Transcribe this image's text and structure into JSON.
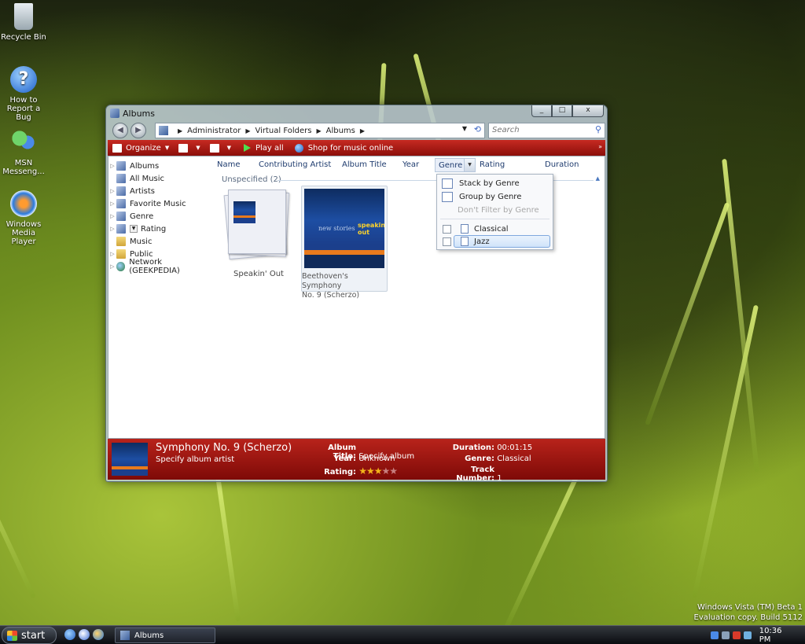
{
  "desktop": {
    "icons": [
      {
        "label": "Recycle Bin"
      },
      {
        "label": "How to Report a Bug"
      },
      {
        "label": "MSN Messeng..."
      },
      {
        "label": "Windows Media Player"
      }
    ],
    "watermark_line1": "Windows Vista (TM) Beta 1",
    "watermark_line2": "Evaluation copy. Build 5112"
  },
  "window": {
    "title": "Albums",
    "controls": {
      "minimize": "_",
      "maximize": "□",
      "close": "x"
    }
  },
  "address": {
    "crumbs": [
      "Administrator",
      "Virtual Folders",
      "Albums"
    ],
    "search_placeholder": "Search"
  },
  "toolbar": {
    "organize": "Organize",
    "play_all": "Play all",
    "shop": "Shop for music online",
    "more": "»"
  },
  "tree": [
    {
      "label": "Albums"
    },
    {
      "label": "All Music"
    },
    {
      "label": "Artists"
    },
    {
      "label": "Favorite Music"
    },
    {
      "label": "Genre"
    },
    {
      "label": "Rating"
    },
    {
      "label": "Music"
    },
    {
      "label": "Public"
    },
    {
      "label": "Network (GEEKPEDIA)"
    }
  ],
  "columns": [
    "Name",
    "Contributing Artist",
    "Album Title",
    "Year",
    "Genre",
    "Rating",
    "Duration"
  ],
  "group": {
    "label": "Unspecified (2)"
  },
  "items": [
    {
      "title": "Speakin' Out"
    },
    {
      "title_line1": "Beethoven's Symphony",
      "title_line2": "No. 9 (Scherzo)",
      "art_text": "new stories",
      "art_text2": "speakin' out"
    }
  ],
  "genre_menu": {
    "stack": "Stack by Genre",
    "group": "Group by Genre",
    "no_filter": "Don't Filter by Genre",
    "options": [
      {
        "label": "Classical",
        "checked": false,
        "highlighted": false
      },
      {
        "label": "Jazz",
        "checked": false,
        "highlighted": true
      }
    ]
  },
  "details": {
    "title": "Symphony No. 9 (Scherzo)",
    "artist": "Specify album artist",
    "album_title_key": "Album Title:",
    "album_title_val": "Specify album",
    "year_key": "Year:",
    "year_val": "Unknown",
    "rating_key": "Rating:",
    "rating_stars": 3,
    "rating_max": 5,
    "duration_key": "Duration:",
    "duration_val": "00:01:15",
    "genre_key": "Genre:",
    "genre_val": "Classical",
    "track_key": "Track Number:",
    "track_val": "1"
  },
  "taskbar": {
    "start": "start",
    "task_label": "Albums",
    "clock": "10:36 PM"
  }
}
